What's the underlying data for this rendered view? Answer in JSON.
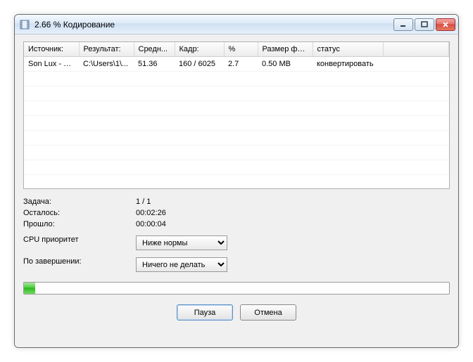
{
  "window": {
    "title": "2.66 % Кодирование"
  },
  "grid": {
    "headers": [
      "Источник:",
      "Результат:",
      "Средн...",
      "Кадр:",
      "%",
      "Размер фа...",
      "статус",
      ""
    ],
    "rows": [
      {
        "source": "Son Lux - Ea...",
        "result": "C:\\Users\\1\\...",
        "avg": "51.36",
        "frame": "160 / 6025",
        "percent": "2.7",
        "size": "0.50 MB",
        "status": "конвертировать"
      }
    ]
  },
  "info": {
    "task_label": "Задача:",
    "task_value": "1 / 1",
    "remain_label": "Осталось:",
    "remain_value": "00:02:26",
    "elapsed_label": "Прошло:",
    "elapsed_value": "00:00:04",
    "cpu_label": "CPU приоритет",
    "cpu_value": "Ниже нормы",
    "after_label": "По завершении:",
    "after_value": "Ничего не делать"
  },
  "progress": {
    "percent": 2.66
  },
  "buttons": {
    "pause": "Пауза",
    "cancel": "Отмена"
  }
}
